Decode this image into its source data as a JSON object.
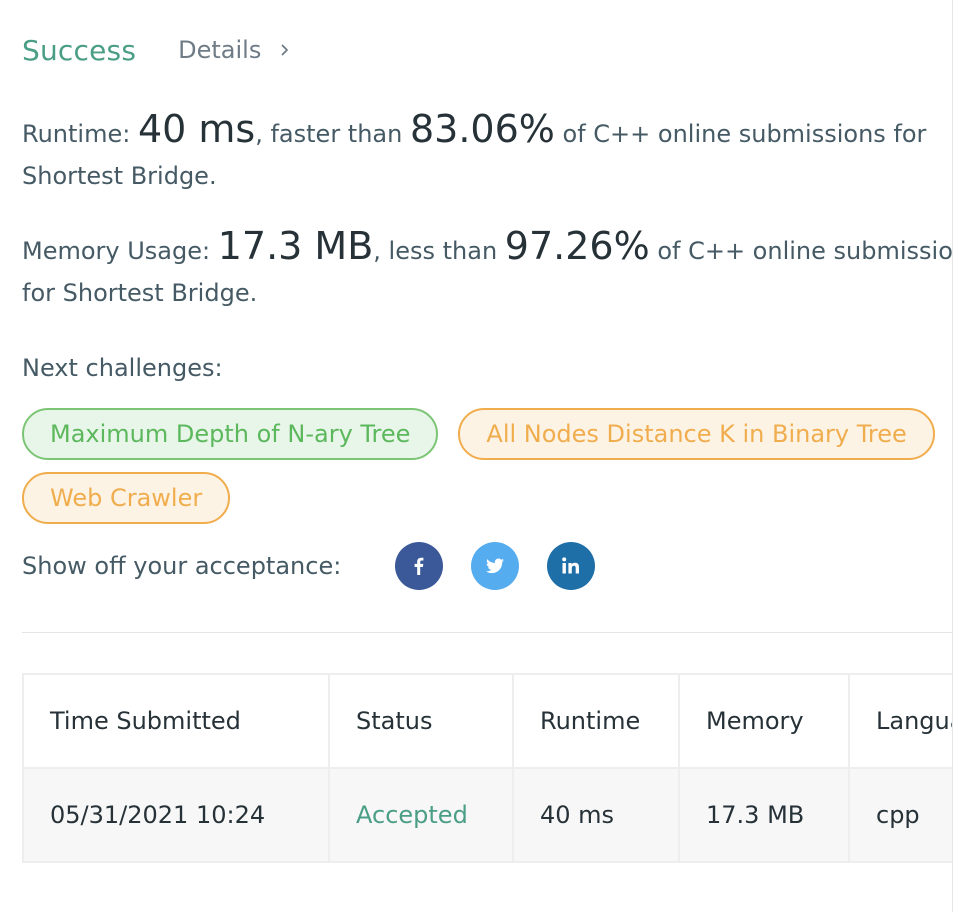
{
  "header": {
    "status": "Success",
    "details_label": "Details"
  },
  "runtime": {
    "prefix": "Runtime: ",
    "value": "40 ms",
    "mid": ", faster than ",
    "percent": "83.06%",
    "suffix_line1": " of C++ online submissions for",
    "suffix_line2": "Shortest Bridge."
  },
  "memory": {
    "prefix": "Memory Usage: ",
    "value": "17.3 MB",
    "mid": ", less than ",
    "percent": "97.26%",
    "suffix_line1": " of C++ online submissions",
    "suffix_line2": "for Shortest Bridge."
  },
  "next_challenges": {
    "title": "Next challenges:",
    "items": [
      {
        "label": "Maximum Depth of N-ary Tree",
        "difficulty": "easy"
      },
      {
        "label": "All Nodes Distance K in Binary Tree",
        "difficulty": "medium"
      },
      {
        "label": "Web Crawler",
        "difficulty": "medium"
      }
    ]
  },
  "share": {
    "label": "Show off your acceptance:",
    "icons": [
      "facebook-icon",
      "twitter-icon",
      "linkedin-icon"
    ]
  },
  "table": {
    "headers": [
      "Time Submitted",
      "Status",
      "Runtime",
      "Memory",
      "Language"
    ],
    "rows": [
      [
        "05/31/2021 10:24",
        "Accepted",
        "40 ms",
        "17.3 MB",
        "cpp"
      ]
    ]
  },
  "colors": {
    "success": "#4b9e86",
    "easy": "#5cb85c",
    "medium": "#f0ad4e",
    "facebook": "#3b5998",
    "twitter": "#55acee",
    "linkedin": "#1e6ea7"
  }
}
